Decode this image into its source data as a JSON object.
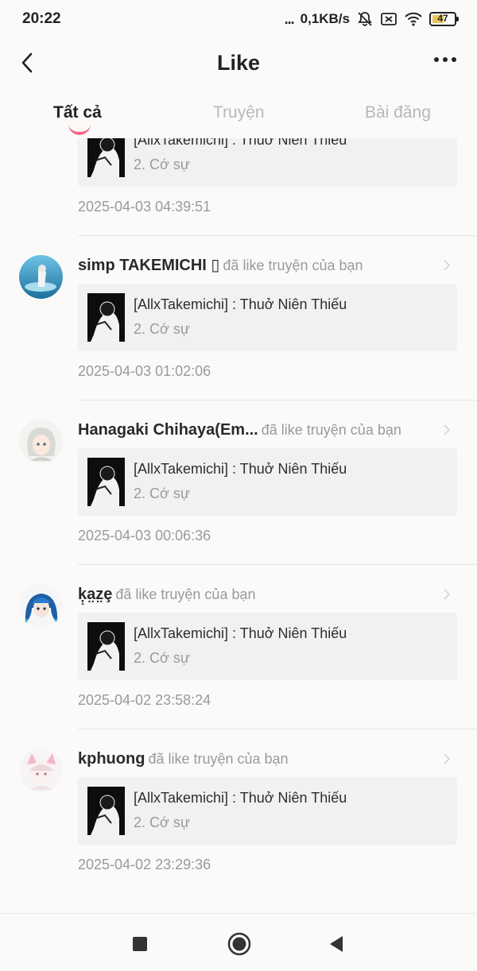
{
  "status_bar": {
    "time": "20:22",
    "dots": "...",
    "speed": "0,1KB/s",
    "battery": "47"
  },
  "header": {
    "title": "Like"
  },
  "tabs": [
    {
      "label": "Tất cả"
    },
    {
      "label": "Truyện"
    },
    {
      "label": "Bài đăng"
    }
  ],
  "partial_item": {
    "story_title": "[AllxTakemichi] : Thuở Niên Thiếu",
    "chapter": "2. Cớ sự",
    "timestamp": "2025-04-03 04:39:51"
  },
  "items": [
    {
      "username": "simp TAKEMICHI ▯",
      "action": "đã like truyện của bạn",
      "story_title": "[AllxTakemichi] : Thuở Niên Thiếu",
      "chapter": "2. Cớ sự",
      "timestamp": "2025-04-03 01:02:06"
    },
    {
      "username": "Hanagaki Chihaya(Em...",
      "action": "đã like truyện của bạn",
      "story_title": "[AllxTakemichi] : Thuở Niên Thiếu",
      "chapter": "2. Cớ sự",
      "timestamp": "2025-04-03 00:06:36"
    },
    {
      "username": "ķ̣a̤z̤ȩ",
      "action": "đã like truyện của bạn",
      "story_title": "[AllxTakemichi] : Thuở Niên Thiếu",
      "chapter": "2. Cớ sự",
      "timestamp": "2025-04-02 23:58:24"
    },
    {
      "username": "kphuong",
      "action": "đã like truyện của bạn",
      "story_title": "[AllxTakemichi] : Thuở Niên Thiếu",
      "chapter": "2. Cớ sự",
      "timestamp": "2025-04-02 23:29:36"
    }
  ],
  "colors": {
    "accent": "#f26b81",
    "background": "#fbfaf9",
    "card": "#f2f1f0",
    "muted_text": "#9a9a9a"
  }
}
